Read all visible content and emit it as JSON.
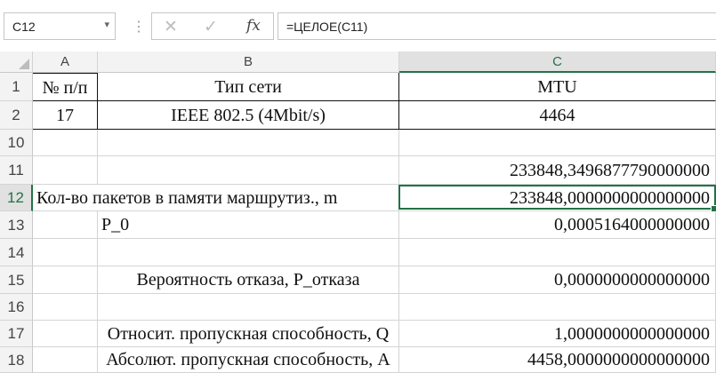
{
  "name_box": {
    "value": "C12",
    "dropdown_glyph": "▾"
  },
  "formula_bar": {
    "cancel_glyph": "✕",
    "enter_glyph": "✓",
    "fx_label": "fx",
    "formula": "=ЦЕЛОЕ(C11)"
  },
  "columns": [
    "A",
    "B",
    "C"
  ],
  "rows": [
    {
      "n": "1",
      "a": "№ п/п",
      "b": "Тип сети",
      "c": "MTU"
    },
    {
      "n": "2",
      "a": "17",
      "b": "IEEE 802.5 (4Mbit/s)",
      "c": "4464"
    },
    {
      "n": "10",
      "a": "",
      "b": "",
      "c": ""
    },
    {
      "n": "11",
      "a": "",
      "b": "",
      "c": "233848,3496877790000000"
    },
    {
      "n": "12",
      "a": "Кол-во пакетов в памяти маршрутиз., m",
      "b": "",
      "c": "233848,0000000000000000"
    },
    {
      "n": "13",
      "a": "",
      "b": "P_0",
      "c": "0,0005164000000000"
    },
    {
      "n": "14",
      "a": "",
      "b": "",
      "c": ""
    },
    {
      "n": "15",
      "a": "",
      "b": "Вероятность отказа, P_отказа",
      "c": "0,0000000000000000"
    },
    {
      "n": "16",
      "a": "",
      "b": "",
      "c": ""
    },
    {
      "n": "17",
      "a": "",
      "b": "Относит. пропускная способность, Q",
      "c": "1,0000000000000000"
    },
    {
      "n": "18",
      "a": "",
      "b": "Абсолют. пропускная способность, A",
      "c": "4458,0000000000000000"
    }
  ],
  "colors": {
    "accent": "#217346",
    "header_bg": "#f3f3f3",
    "gridline": "#d4d4d4"
  }
}
